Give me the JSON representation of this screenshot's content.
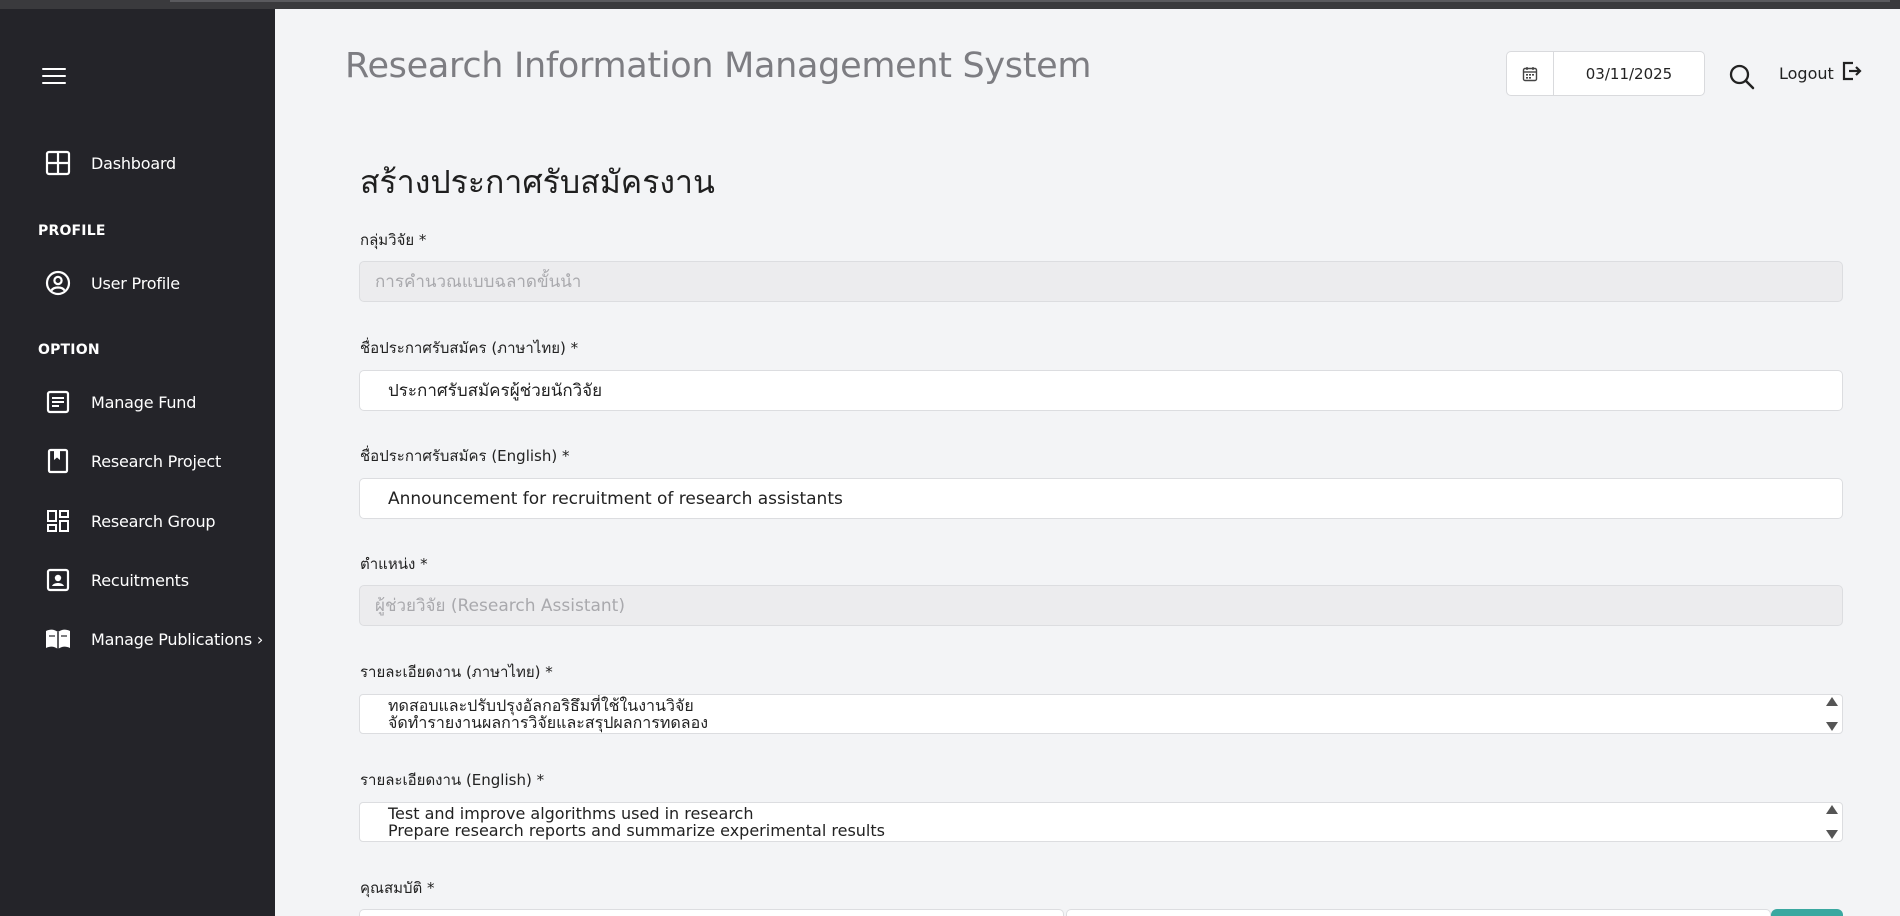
{
  "app": {
    "title": "Research Information Management System"
  },
  "header": {
    "date": "03/11/2025",
    "logout_label": "Logout",
    "date_icon": "calendar-icon",
    "search_icon": "search-icon",
    "logout_icon": "logout-icon"
  },
  "sidebar": {
    "dashboard": "Dashboard",
    "profile_section": "PROFILE",
    "user_profile": "User Profile",
    "option_section": "OPTION",
    "items": [
      {
        "label": "Manage Fund",
        "icon": "document-list-icon"
      },
      {
        "label": "Research Project",
        "icon": "bookmark-icon"
      },
      {
        "label": "Research Group",
        "icon": "grid-layout-icon"
      },
      {
        "label": "Recuitments",
        "icon": "id-card-icon"
      },
      {
        "label": "Manage Publications ›",
        "icon": "open-book-icon"
      }
    ]
  },
  "form": {
    "heading": "สร้างประกาศรับสมัครงาน",
    "research_group": {
      "label": "กลุ่มวิจัย *",
      "value": "การคำนวณแบบฉลาดขั้นนำ"
    },
    "title_th": {
      "label": "ชื่อประกาศรับสมัคร (ภาษาไทย) *",
      "value": "ประกาศรับสมัครผู้ช่วยนักวิจัย"
    },
    "title_en": {
      "label": "ชื่อประกาศรับสมัคร (English) *",
      "value": "Announcement for recruitment of research assistants"
    },
    "position": {
      "label": "ตำแหน่ง *",
      "value": "ผู้ช่วยวิจัย (Research Assistant)"
    },
    "detail_th": {
      "label": "รายละเอียดงาน (ภาษาไทย) *",
      "line1": "ทดสอบและปรับปรุงอัลกอริธึมที่ใช้ในงานวิจัย",
      "line2": "จัดทำรายงานผลการวิจัยและสรุปผลการทดลอง"
    },
    "detail_en": {
      "label": "รายละเอียดงาน (English) *",
      "line1": "Test and improve algorithms used in research",
      "line2": "Prepare research reports and summarize experimental results"
    },
    "qualification": {
      "label": "คุณสมบัติ *"
    }
  },
  "colors": {
    "sidebar_bg": "#242429",
    "page_bg": "#f3f4f6",
    "accent": "#3aa8a0"
  }
}
